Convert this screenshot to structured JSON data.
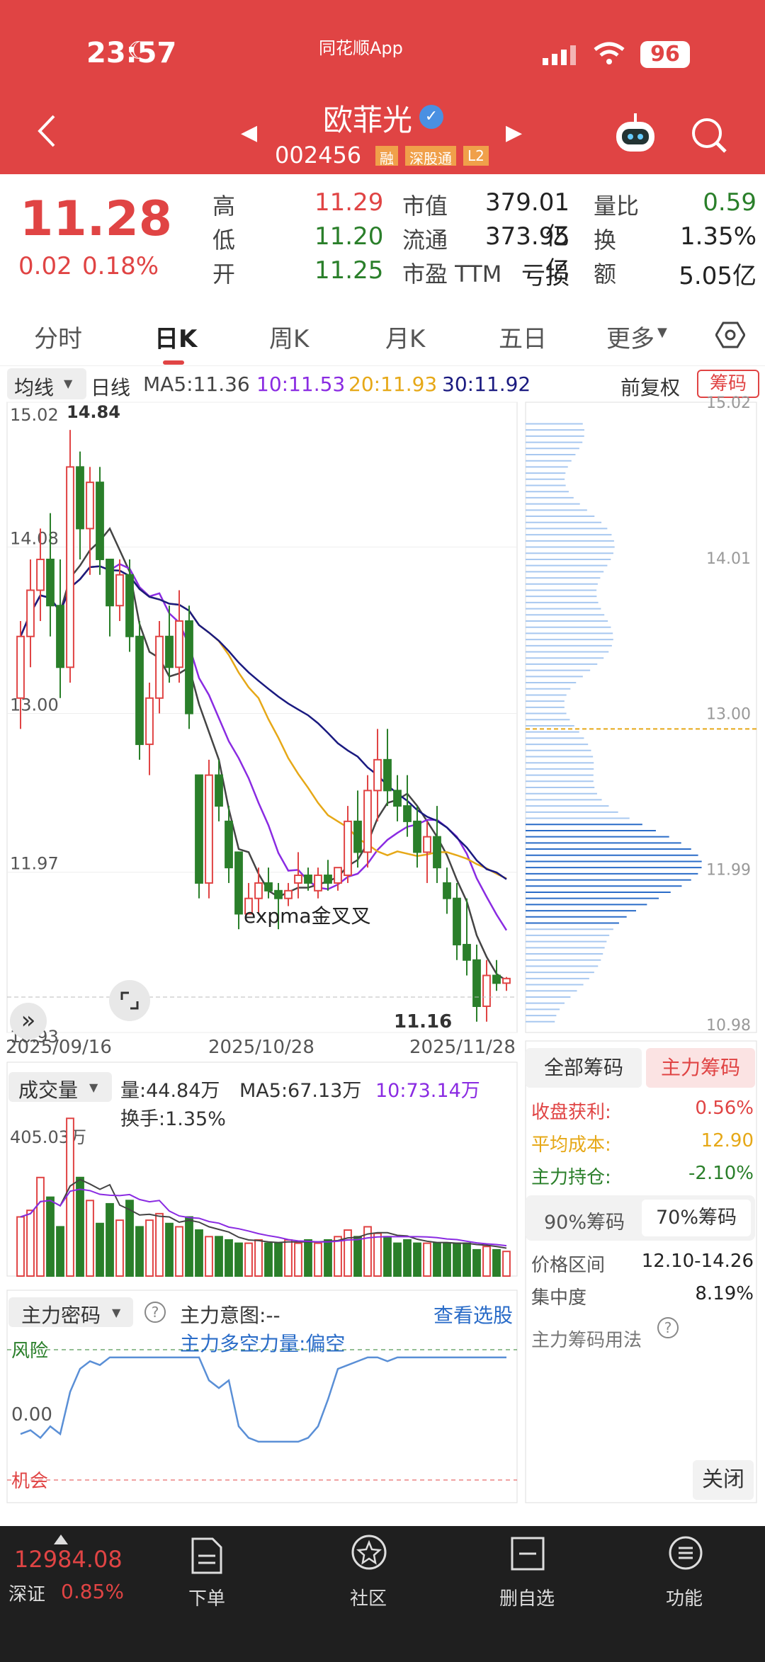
{
  "status": {
    "time": "23:57",
    "app": "同花顺App",
    "battery": "96"
  },
  "stock": {
    "name": "欧菲光",
    "code": "002456",
    "tags": [
      "融",
      "深股通",
      "L2"
    ]
  },
  "quote": {
    "price": "11.28",
    "change": "0.02",
    "pct": "0.18%",
    "rows": [
      {
        "l1": "高",
        "v1": "11.29",
        "l2": "市值",
        "v2": "379.01亿",
        "l3": "量比",
        "v3": "0.59"
      },
      {
        "l1": "低",
        "v1": "11.20",
        "l2": "流通",
        "v2": "373.95亿",
        "l3": "换",
        "v3": "1.35%"
      },
      {
        "l1": "开",
        "v1": "11.25",
        "l2": "市盈 TTM",
        "v2": "亏损",
        "l3": "额",
        "v3": "5.05亿"
      }
    ]
  },
  "tabs": [
    "分时",
    "日K",
    "周K",
    "月K",
    "五日",
    "更多"
  ],
  "ma": {
    "sel": "均线",
    "period": "日线",
    "ma5": "MA5:11.36",
    "ma10": "10:11.53",
    "ma20": "20:11.93",
    "ma30": "30:11.92",
    "fq": "前复权",
    "chips": "筹码"
  },
  "colors": {
    "up": "#e04444",
    "down": "#2a7f2a",
    "ma5": "#444444",
    "ma10": "#8a2be2",
    "ma20": "#e6a817",
    "ma30": "#1a1a80",
    "chip": "#2a6cc8"
  },
  "chart_data": [
    {
      "type": "candlestick",
      "title": "",
      "dates_shown": [
        "2025/09/16",
        "2025/10/28",
        "2025/11/28"
      ],
      "y_ticks": [
        "15.02",
        "14.08",
        "13.00",
        "11.97",
        "10.93"
      ],
      "max_label": "14.84",
      "min_label": "11.16",
      "annotation": "expma金叉叉",
      "ohlc": [
        [
          13.1,
          13.6,
          12.9,
          13.5
        ],
        [
          13.5,
          14.0,
          13.3,
          13.8
        ],
        [
          13.8,
          14.2,
          13.6,
          14.0
        ],
        [
          14.0,
          14.3,
          13.5,
          13.7
        ],
        [
          13.7,
          14.0,
          13.1,
          13.3
        ],
        [
          13.3,
          14.84,
          13.2,
          14.6
        ],
        [
          14.6,
          14.7,
          14.0,
          14.2
        ],
        [
          14.2,
          14.6,
          13.9,
          14.5
        ],
        [
          14.5,
          14.6,
          13.9,
          14.0
        ],
        [
          14.0,
          14.0,
          13.5,
          13.7
        ],
        [
          13.7,
          14.0,
          13.6,
          13.9
        ],
        [
          13.9,
          14.0,
          13.4,
          13.5
        ],
        [
          13.5,
          13.6,
          12.7,
          12.8
        ],
        [
          12.8,
          13.2,
          12.6,
          13.1
        ],
        [
          13.1,
          13.6,
          13.0,
          13.5
        ],
        [
          13.5,
          13.7,
          13.2,
          13.3
        ],
        [
          13.3,
          13.8,
          13.2,
          13.6
        ],
        [
          13.6,
          13.7,
          12.9,
          13.0
        ],
        [
          12.6,
          12.6,
          11.8,
          11.9
        ],
        [
          11.9,
          12.7,
          11.8,
          12.6
        ],
        [
          12.6,
          12.7,
          12.3,
          12.4
        ],
        [
          12.3,
          12.4,
          11.9,
          12.0
        ],
        [
          12.1,
          12.1,
          11.6,
          11.7
        ],
        [
          11.7,
          11.9,
          11.7,
          11.8
        ],
        [
          11.8,
          12.0,
          11.7,
          11.9
        ],
        [
          11.9,
          12.0,
          11.8,
          11.85
        ],
        [
          11.85,
          11.9,
          11.6,
          11.8
        ],
        [
          11.8,
          11.9,
          11.75,
          11.85
        ],
        [
          11.9,
          12.1,
          11.8,
          11.95
        ],
        [
          11.95,
          12.0,
          11.85,
          11.9
        ],
        [
          11.85,
          12.0,
          11.8,
          11.95
        ],
        [
          11.95,
          12.05,
          11.85,
          11.9
        ],
        [
          11.9,
          12.0,
          11.85,
          12.0
        ],
        [
          11.95,
          12.4,
          11.9,
          12.3
        ],
        [
          12.3,
          12.5,
          12.0,
          12.1
        ],
        [
          12.1,
          12.6,
          12.0,
          12.5
        ],
        [
          12.5,
          12.9,
          12.3,
          12.7
        ],
        [
          12.7,
          12.9,
          12.4,
          12.5
        ],
        [
          12.5,
          12.6,
          12.3,
          12.4
        ],
        [
          12.4,
          12.6,
          12.2,
          12.3
        ],
        [
          12.3,
          12.4,
          12.0,
          12.1
        ],
        [
          12.1,
          12.3,
          11.9,
          12.2
        ],
        [
          12.2,
          12.4,
          11.9,
          12.0
        ],
        [
          11.9,
          12.0,
          11.7,
          11.8
        ],
        [
          11.8,
          11.9,
          11.4,
          11.5
        ],
        [
          11.5,
          11.8,
          11.3,
          11.4
        ],
        [
          11.4,
          11.5,
          11.0,
          11.1
        ],
        [
          11.1,
          11.4,
          11.0,
          11.3
        ],
        [
          11.3,
          11.4,
          11.2,
          11.25
        ],
        [
          11.25,
          11.29,
          11.2,
          11.28
        ]
      ]
    },
    {
      "type": "bar",
      "title": "成交量",
      "labels": [
        "量:44.84万",
        "MA5:67.13万",
        "10:73.14万",
        "换手:1.35%"
      ],
      "ytick": "405.03万",
      "values": [
        180,
        200,
        300,
        240,
        150,
        480,
        300,
        230,
        160,
        220,
        170,
        230,
        150,
        170,
        190,
        160,
        150,
        180,
        140,
        120,
        120,
        110,
        100,
        100,
        110,
        100,
        100,
        110,
        100,
        110,
        100,
        110,
        120,
        140,
        120,
        150,
        130,
        120,
        100,
        110,
        100,
        100,
        100,
        100,
        100,
        100,
        80,
        90,
        80,
        75
      ]
    },
    {
      "type": "line",
      "title": "主力密码",
      "intent": "主力意图:--",
      "power": "主力多空力量:偏空",
      "link": "查看选股",
      "risk": "风险",
      "chance": "机会",
      "zero": "0.00",
      "values": [
        -0.5,
        -0.4,
        -0.6,
        -0.3,
        -0.5,
        0.6,
        1.2,
        1.4,
        1.3,
        1.5,
        1.5,
        1.5,
        1.5,
        1.5,
        1.5,
        1.5,
        1.5,
        1.5,
        1.5,
        0.9,
        0.7,
        0.9,
        -0.3,
        -0.6,
        -0.7,
        -0.7,
        -0.7,
        -0.7,
        -0.7,
        -0.6,
        -0.3,
        0.4,
        1.2,
        1.3,
        1.4,
        1.5,
        1.5,
        1.4,
        1.5,
        1.5,
        1.5,
        1.5,
        1.5,
        1.5,
        1.5,
        1.5,
        1.5,
        1.5,
        1.5,
        1.5
      ]
    }
  ],
  "chips": {
    "ticks": [
      "15.02",
      "14.01",
      "13.00",
      "11.99",
      "10.98"
    ],
    "tabAll": "全部筹码",
    "tabMain": "主力筹码",
    "rows": [
      {
        "k": "收盘获利:",
        "v": "0.56%"
      },
      {
        "k": "平均成本:",
        "v": "12.90"
      },
      {
        "k": "主力持仓:",
        "v": "-2.10%"
      }
    ],
    "sub": [
      "90%筹码",
      "70%筹码"
    ],
    "rows2": [
      {
        "k": "价格区间",
        "v": "12.10-14.26"
      },
      {
        "k": "集中度",
        "v": "8.19%"
      }
    ],
    "usage": "主力筹码用法",
    "close": "关闭"
  },
  "footer": {
    "index": "12984.08",
    "name": "深证",
    "pct": "0.85%",
    "items": [
      "下单",
      "社区",
      "删自选",
      "功能"
    ]
  }
}
